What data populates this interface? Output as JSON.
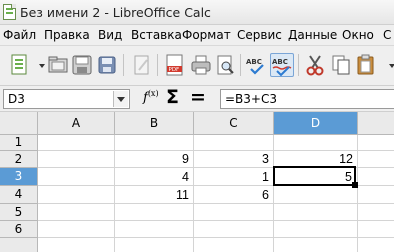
{
  "window": {
    "title": "Без имени 2 - LibreOffice Calc"
  },
  "menu": {
    "items": [
      {
        "label": "Файл"
      },
      {
        "label": "Правка"
      },
      {
        "label": "Вид"
      },
      {
        "label": "Вставка"
      },
      {
        "label": "Формат"
      },
      {
        "label": "Сервис"
      },
      {
        "label": "Данные"
      },
      {
        "label": "Окно"
      },
      {
        "label": "С"
      }
    ]
  },
  "toolbar": {
    "icons": [
      "new-document-icon",
      "open-folder-icon",
      "save-icon",
      "save-as-icon",
      "edit-file-icon",
      "export-pdf-icon",
      "print-icon",
      "print-preview-icon",
      "spellcheck-icon",
      "autospellcheck-icon",
      "cut-icon",
      "copy-icon",
      "paste-icon"
    ]
  },
  "formula_bar": {
    "name_box": "D3",
    "formula": "=B3+C3"
  },
  "sheet": {
    "columns": [
      "A",
      "B",
      "C",
      "D"
    ],
    "rows": [
      "1",
      "2",
      "3",
      "4",
      "5",
      "6"
    ],
    "selected_cell": "D3",
    "cells": {
      "B2": "9",
      "C2": "3",
      "D2": "12",
      "B3": "4",
      "C3": "1",
      "D3": "5",
      "B4": "11",
      "C4": "6"
    }
  },
  "colors": {
    "selection_header": "#5b9bd5"
  }
}
